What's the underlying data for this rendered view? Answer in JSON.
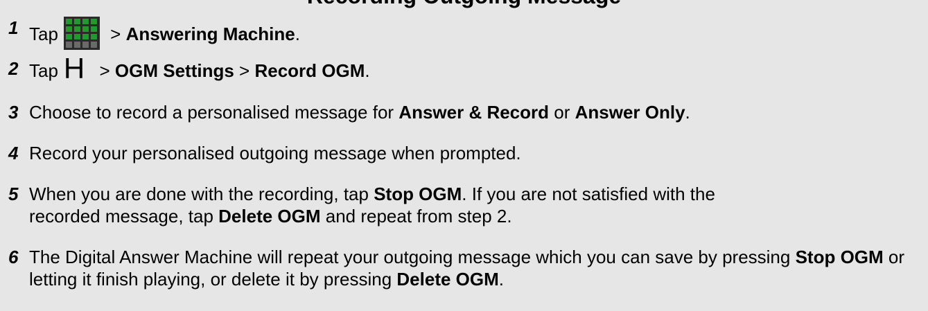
{
  "heading": "Recording Outgoing Message",
  "steps": [
    {
      "num": "1",
      "t1": "Tap",
      "icon": "grid-icon",
      "t2": " > ",
      "b1": "Answering Machine",
      "t3": "."
    },
    {
      "num": "2",
      "t1": "Tap",
      "icon": "h-icon",
      "icon_glyph": "H",
      "t2": " > ",
      "b1": "OGM Settings",
      "t3": " > ",
      "b2": "Record OGM",
      "t4": "."
    },
    {
      "num": "3",
      "t1": "Choose to record a personalised message for ",
      "b1": "Answer & Record",
      "t2": " or ",
      "b2": "Answer Only",
      "t3": "."
    },
    {
      "num": "4",
      "t1": "Record your personalised outgoing message when prompted."
    },
    {
      "num": "5",
      "t1": "When you are done with the recording, tap ",
      "b1": "Stop OGM",
      "t2": ". If you are not satisfied with the recorded message, tap ",
      "b2": "Delete OGM",
      "t3": " and repeat from step 2."
    },
    {
      "num": "6",
      "t1": "The Digital Answer Machine will repeat your outgoing message which you can save by pressing ",
      "b1": "Stop OGM",
      "t2": " or letting it finish playing, or delete it by pressing ",
      "b2": "Delete OGM",
      "t3": "."
    }
  ]
}
